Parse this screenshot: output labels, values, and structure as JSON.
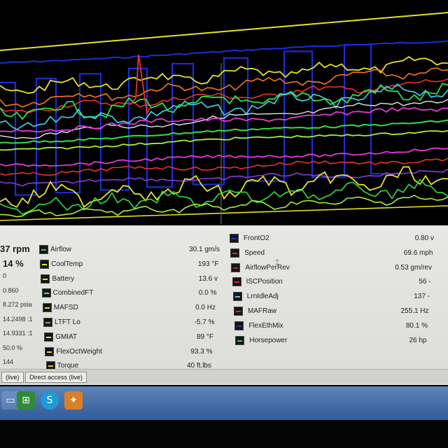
{
  "left_readings": [
    {
      "value": "37 rpm"
    },
    {
      "value": "14 %"
    },
    {
      "value": "0"
    },
    {
      "value": "0.860"
    },
    {
      "value": "8.272 psia"
    },
    {
      "value": "14.2498 :1"
    },
    {
      "value": "14.9331 :1"
    },
    {
      "value": "50.0 %"
    },
    {
      "value": "144"
    }
  ],
  "sensors_col1": [
    {
      "name": "Airflow",
      "value": "30.1 gm/s",
      "color": "#2bd94a"
    },
    {
      "name": "CoolTemp",
      "value": "193 °F",
      "color": "#e4e33a"
    },
    {
      "name": "Battery",
      "value": "13.6 v",
      "color": "#f0e040"
    },
    {
      "name": "CombinedFT",
      "value": "0.0 %",
      "color": "#56d4e6"
    },
    {
      "name": "MAFSD",
      "value": "0.0 Hz",
      "color": "#f0d820"
    },
    {
      "name": "LTFT Lo",
      "value": "-5.7 %",
      "color": "#9b9b9b"
    },
    {
      "name": "GMIAT",
      "value": "89 °F",
      "color": "#e8e040"
    },
    {
      "name": "FlexOctWeight",
      "value": "93.3 %",
      "color": "#e6d62a"
    },
    {
      "name": "Torque",
      "value": "40 ft.lbs",
      "color": "#d6d62a"
    }
  ],
  "sensors_col2": [
    {
      "name": "FrontO2",
      "value": "0.80 v",
      "color": "#2236c8"
    },
    {
      "name": "Speed",
      "value": "69.6 mph",
      "color": "#e02a2a"
    },
    {
      "name": "AirflowPerRev",
      "value": "0.53 gm/rev",
      "color": "#cc2222"
    },
    {
      "name": "ISCPosition",
      "value": "56 -",
      "color": "#e02a2a"
    },
    {
      "name": "LrnIdleAdj",
      "value": "137 -",
      "color": "#48d2de"
    },
    {
      "name": "MAFRaw",
      "value": "255.1 Hz",
      "color": "#e02a2a"
    },
    {
      "name": "FlexEthMix",
      "value": "80.1 %",
      "color": "#2a36d8"
    },
    {
      "name": "Horsepower",
      "value": "26 hp",
      "color": "#2bd94a"
    }
  ],
  "tabs": [
    {
      "label": "(live)"
    },
    {
      "label": "Direct access (live)"
    }
  ],
  "taskbar_icons": [
    {
      "name": "monitor-icon",
      "glyph": "▭"
    },
    {
      "name": "spreadsheet-icon",
      "glyph": "⊞"
    },
    {
      "name": "skype-icon",
      "glyph": "S"
    },
    {
      "name": "app-icon",
      "glyph": "✦"
    }
  ],
  "chart_colors": {
    "blue": "#1b2dd8",
    "yellow": "#e6e22e",
    "red": "#e8332a",
    "orange": "#f07a22",
    "green": "#30e040",
    "lime": "#a6f03a",
    "cyan": "#3ed8f0",
    "magenta": "#e23ad8",
    "violet": "#8a3ae0",
    "white": "#e6e6e6"
  }
}
